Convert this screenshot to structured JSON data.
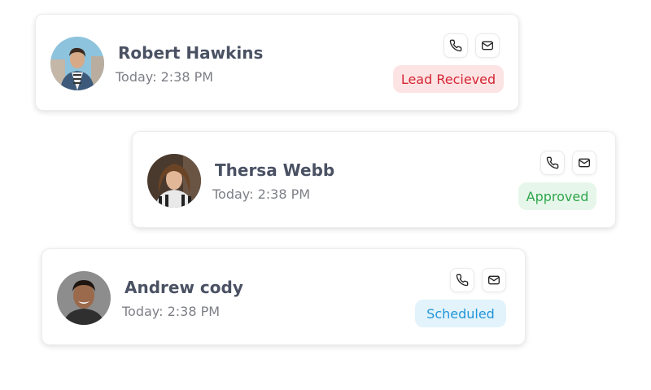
{
  "contacts": [
    {
      "name": "Robert Hawkins",
      "time": "Today: 2:38 PM",
      "status": "Lead Recieved",
      "status_color": "#d42434",
      "status_bg": "#fde4e4",
      "phone_icon": "phone-icon",
      "mail_icon": "mail-icon"
    },
    {
      "name": "Thersa Webb",
      "time": "Today: 2:38 PM",
      "status": "Approved",
      "status_color": "#2fa64c",
      "status_bg": "#e7f6ea",
      "phone_icon": "phone-icon",
      "mail_icon": "mail-icon"
    },
    {
      "name": "Andrew cody",
      "time": "Today: 2:38 PM",
      "status": "Scheduled",
      "status_color": "#2295d6",
      "status_bg": "#e2f3fc",
      "phone_icon": "phone-icon",
      "mail_icon": "mail-icon"
    }
  ]
}
